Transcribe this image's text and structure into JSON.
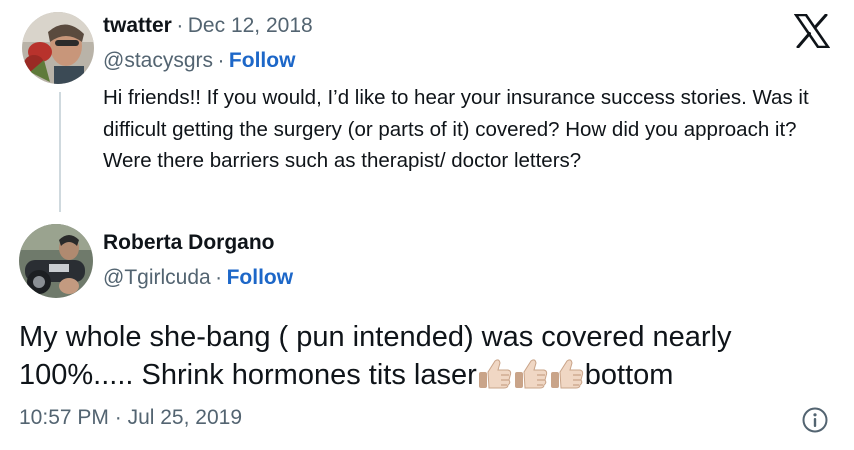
{
  "quoted": {
    "display_name": "twatter",
    "separator": "·",
    "date": "Dec 12, 2018",
    "handle": "@stacysgrs",
    "follow_label": "Follow",
    "text": "Hi friends!! If you would, I’d like to hear your insurance success stories. Was it difficult getting the surgery (or parts of it) covered? How did you approach it? Were there barriers such as therapist/ doctor letters?"
  },
  "reply": {
    "display_name": "Roberta Dorgano",
    "handle": "@Tgirlcuda",
    "separator": "·",
    "follow_label": "Follow",
    "text_before_emoji": "My whole she-bang ( pun intended) was covered nearly 100%..... Shrink hormones tits laser",
    "emoji": "thumbs-up-light-skin-tone",
    "emoji_count": 3,
    "text_after_emoji": "bottom"
  },
  "footer": {
    "time": "10:57 PM",
    "separator": "·",
    "date": "Jul 25, 2019"
  },
  "colors": {
    "text": "#0f1419",
    "muted": "#536471",
    "link": "#1d67c8",
    "thread_line": "#cfd9de"
  },
  "icons": [
    "x-logo-icon",
    "info-icon"
  ]
}
